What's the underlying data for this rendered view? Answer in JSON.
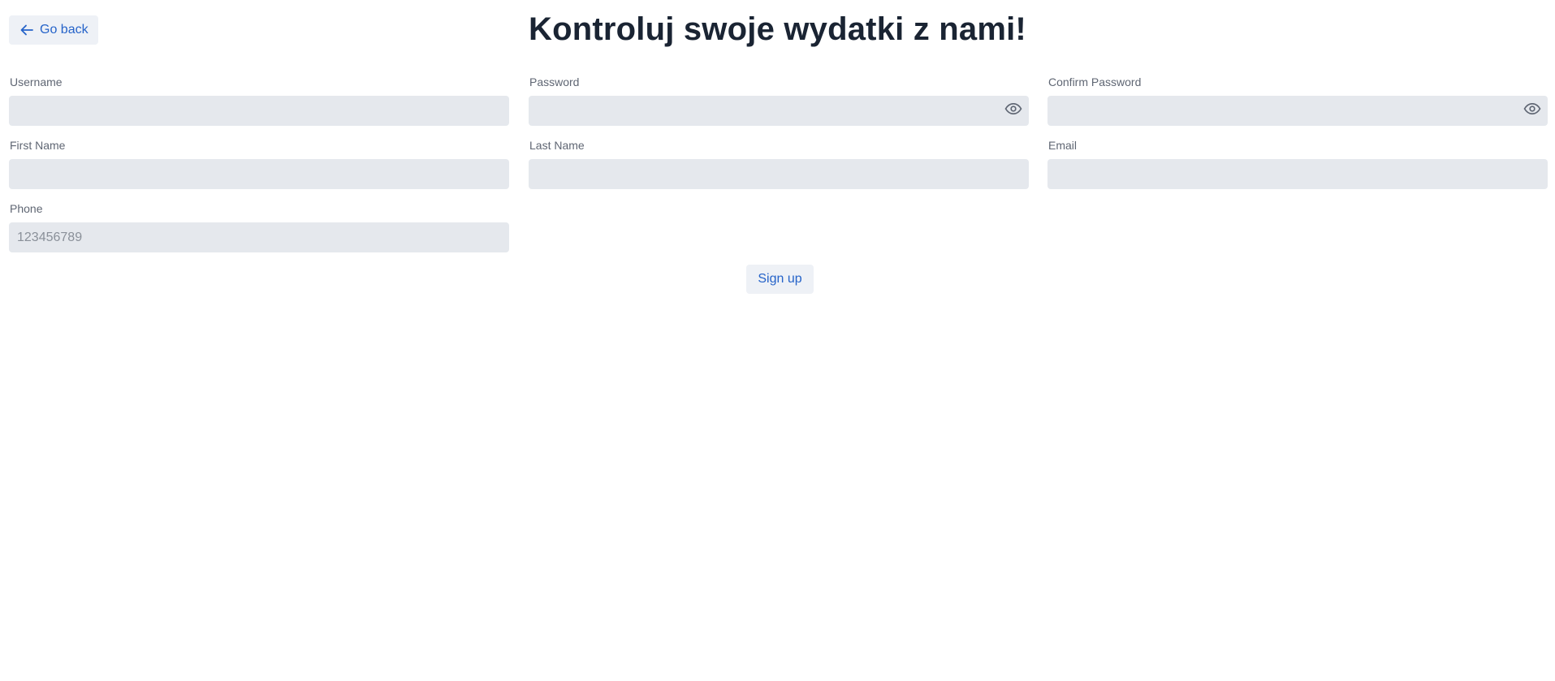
{
  "header": {
    "back_label": "Go back",
    "title": "Kontroluj swoje wydatki z nami!"
  },
  "form": {
    "username": {
      "label": "Username",
      "placeholder": ""
    },
    "password": {
      "label": "Password",
      "placeholder": ""
    },
    "confirm_password": {
      "label": "Confirm Password",
      "placeholder": ""
    },
    "first_name": {
      "label": "First Name",
      "placeholder": ""
    },
    "last_name": {
      "label": "Last Name",
      "placeholder": ""
    },
    "email": {
      "label": "Email",
      "placeholder": ""
    },
    "phone": {
      "label": "Phone",
      "placeholder": "123456789"
    },
    "submit_label": "Sign up"
  },
  "icons": {
    "back": "arrow-left-icon",
    "password_toggle": "eye-icon"
  },
  "colors": {
    "accent": "#2563c9",
    "title": "#1a2433",
    "input_bg": "#e5e8ed",
    "button_bg": "#eef1f6",
    "label": "#5f6673"
  }
}
